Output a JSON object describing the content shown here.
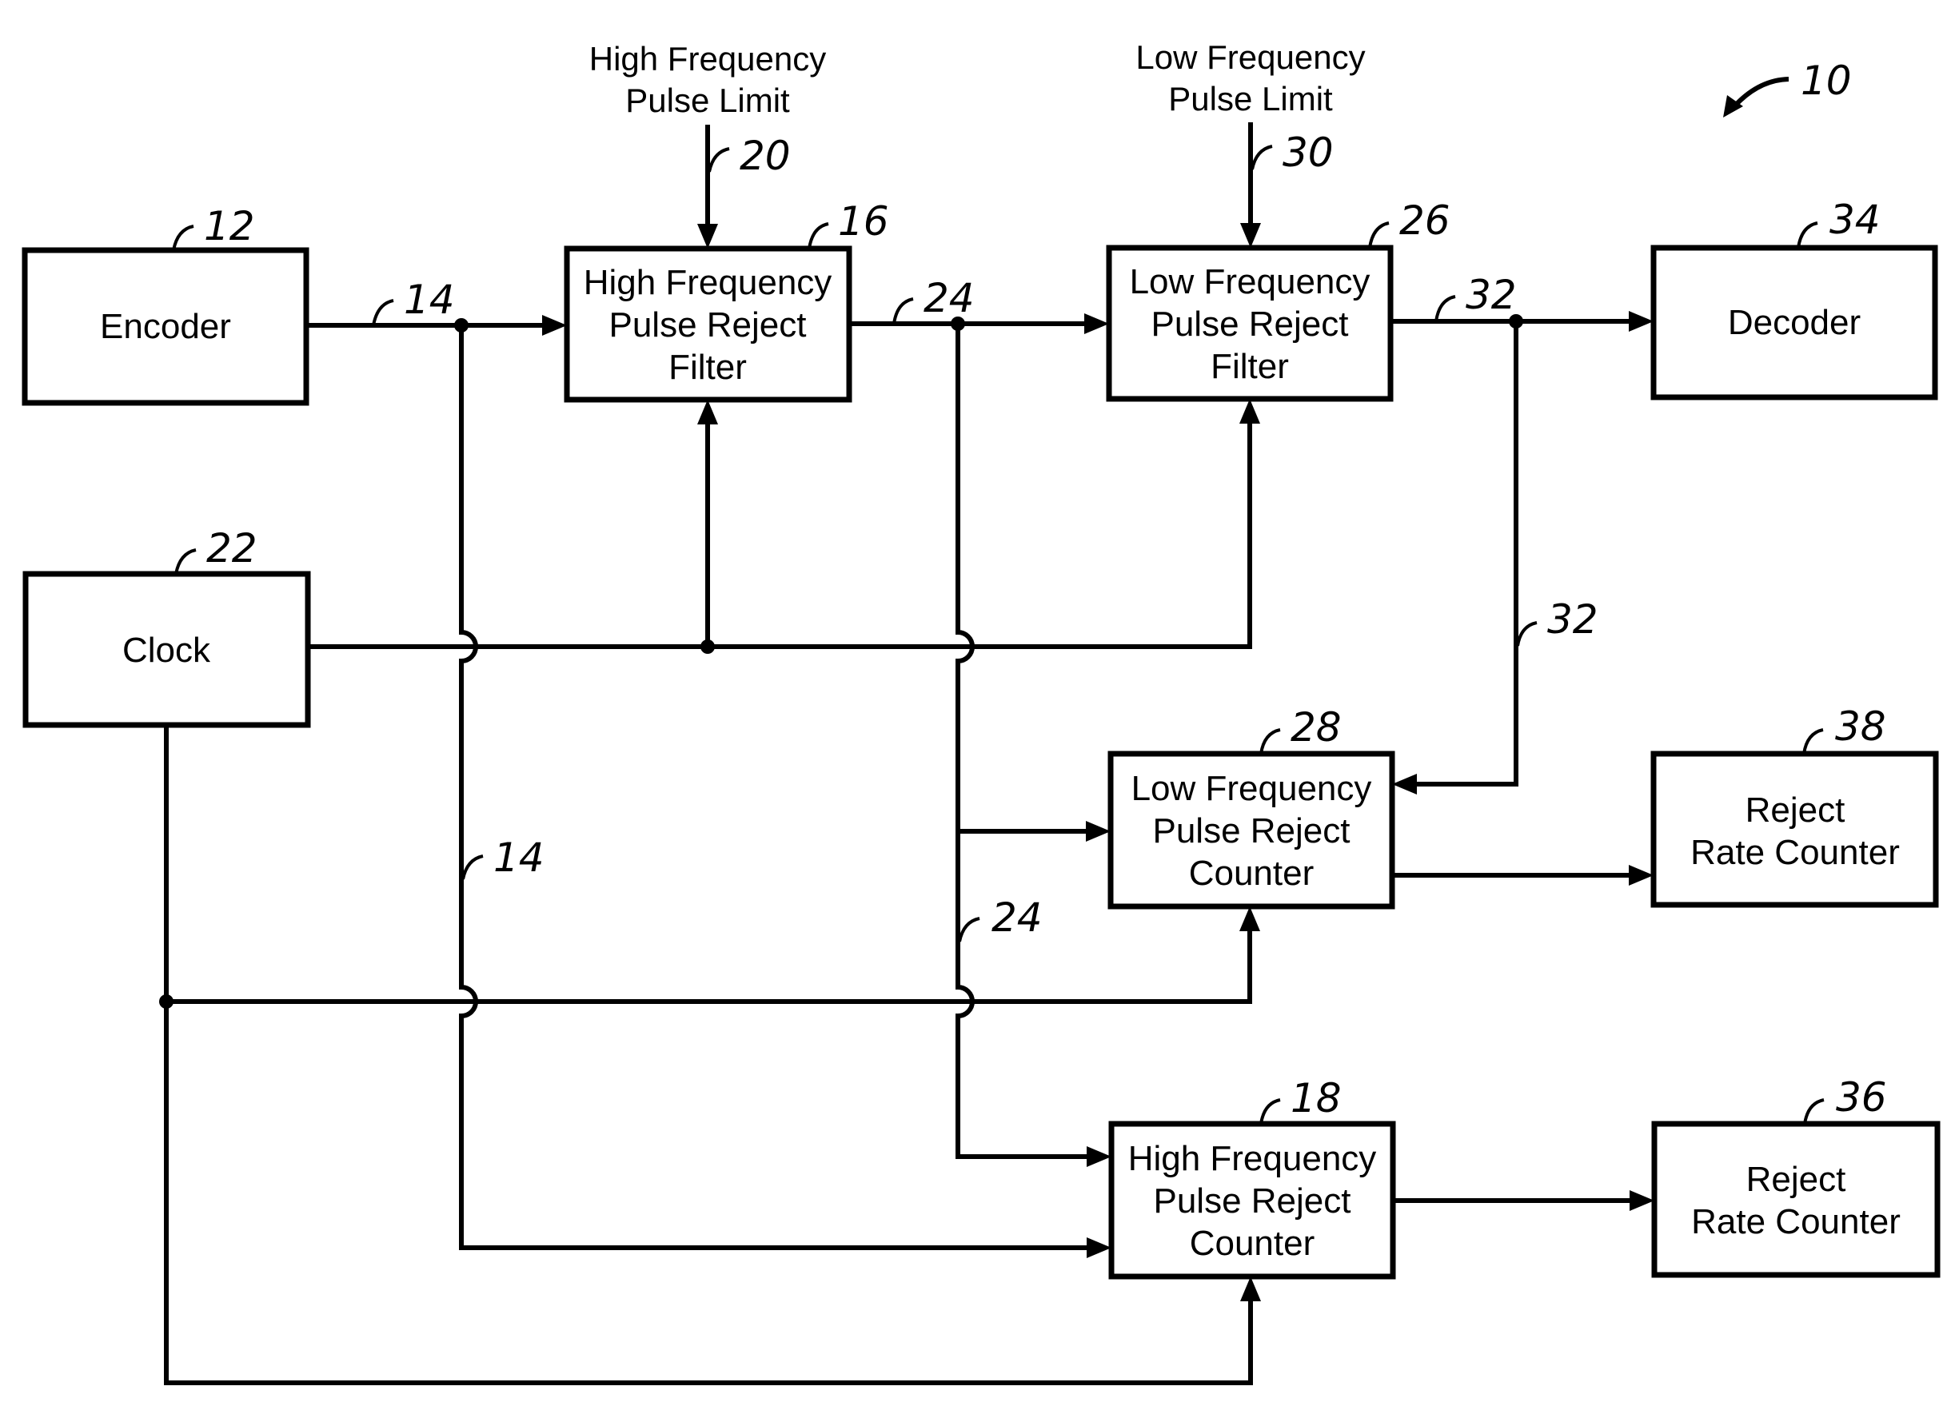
{
  "figure_ref": "10",
  "blocks": {
    "encoder": {
      "ref": "12",
      "lines": [
        "Encoder"
      ]
    },
    "hf_filter": {
      "ref": "16",
      "lines": [
        "High Frequency",
        "Pulse Reject",
        "Filter"
      ]
    },
    "lf_filter": {
      "ref": "26",
      "lines": [
        "Low Frequency",
        "Pulse Reject",
        "Filter"
      ]
    },
    "decoder": {
      "ref": "34",
      "lines": [
        "Decoder"
      ]
    },
    "clock": {
      "ref": "22",
      "lines": [
        "Clock"
      ]
    },
    "lf_counter": {
      "ref": "28",
      "lines": [
        "Low Frequency",
        "Pulse Reject",
        "Counter"
      ]
    },
    "reject_rate_lf": {
      "ref": "38",
      "lines": [
        "Reject",
        "Rate Counter"
      ]
    },
    "hf_counter": {
      "ref": "18",
      "lines": [
        "High Frequency",
        "Pulse Reject",
        "Counter"
      ]
    },
    "reject_rate_hf": {
      "ref": "36",
      "lines": [
        "Reject",
        "Rate Counter"
      ]
    }
  },
  "inputs": {
    "hf_limit": {
      "ref": "20",
      "lines": [
        "High Frequency",
        "Pulse Limit"
      ]
    },
    "lf_limit": {
      "ref": "30",
      "lines": [
        "Low Frequency",
        "Pulse Limit"
      ]
    }
  },
  "signals": {
    "encoder_out": "14",
    "encoder_out_branch": "14",
    "hf_filter_out": "24",
    "hf_filter_out_branch": "24",
    "lf_filter_out": "32",
    "lf_filter_out_branch": "32"
  },
  "connections": [
    {
      "from": "encoder",
      "to": "hf_filter",
      "signal": "14"
    },
    {
      "from": "hf_filter",
      "to": "lf_filter",
      "signal": "24"
    },
    {
      "from": "lf_filter",
      "to": "decoder",
      "signal": "32"
    },
    {
      "from": "hf_limit",
      "to": "hf_filter",
      "signal": "20"
    },
    {
      "from": "lf_limit",
      "to": "lf_filter",
      "signal": "30"
    },
    {
      "from": "clock",
      "to": "hf_filter"
    },
    {
      "from": "clock",
      "to": "lf_filter"
    },
    {
      "from": "clock",
      "to": "lf_counter"
    },
    {
      "from": "clock",
      "to": "hf_counter"
    },
    {
      "from": "encoder",
      "to": "hf_counter",
      "signal": "14"
    },
    {
      "from": "hf_filter",
      "to": "lf_counter",
      "signal": "24"
    },
    {
      "from": "hf_filter",
      "to": "hf_counter",
      "signal": "24"
    },
    {
      "from": "lf_filter",
      "to": "lf_counter",
      "signal": "32"
    },
    {
      "from": "lf_counter",
      "to": "reject_rate_lf"
    },
    {
      "from": "hf_counter",
      "to": "reject_rate_hf"
    }
  ]
}
